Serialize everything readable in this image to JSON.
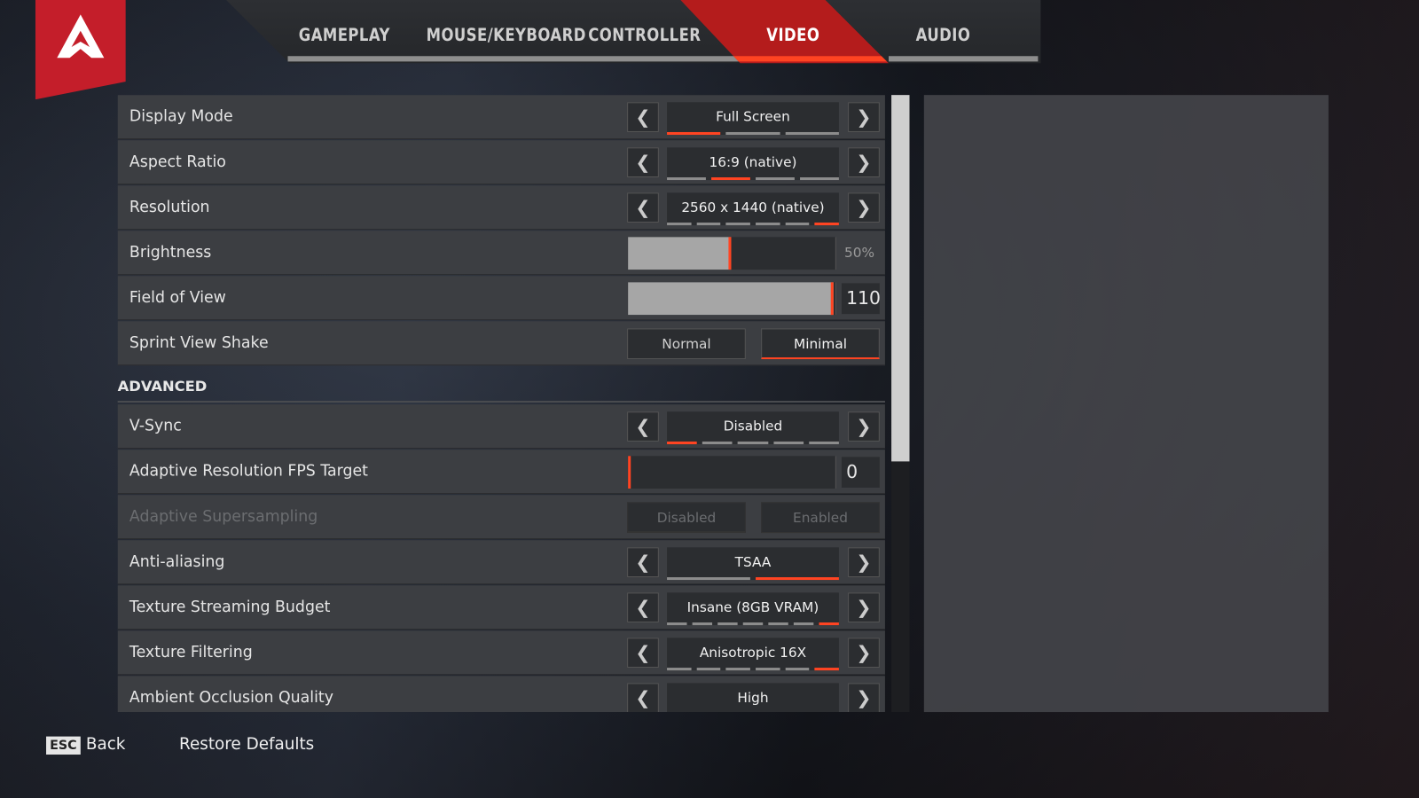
{
  "tabs": [
    {
      "label": "GAMEPLAY"
    },
    {
      "label": "MOUSE/KEYBOARD"
    },
    {
      "label": "CONTROLLER"
    },
    {
      "label": "VIDEO",
      "active": true
    },
    {
      "label": "AUDIO"
    }
  ],
  "accent": "#ff4422",
  "advanced_header": "ADVANCED",
  "rows": [
    {
      "label": "Display Mode",
      "type": "select",
      "value": "Full Screen",
      "options_count": 3,
      "selected_index": 0
    },
    {
      "label": "Aspect Ratio",
      "type": "select",
      "value": "16:9 (native)",
      "options_count": 4,
      "selected_index": 1
    },
    {
      "label": "Resolution",
      "type": "select",
      "value": "2560 x 1440 (native)",
      "options_count": 6,
      "selected_index": 5
    },
    {
      "label": "Brightness",
      "type": "slider",
      "value": "50%",
      "fraction": 0.5
    },
    {
      "label": "Field of View",
      "type": "slider_box",
      "value": "110",
      "fraction": 1.0
    },
    {
      "label": "Sprint View Shake",
      "type": "toggle",
      "options": [
        "Normal",
        "Minimal"
      ],
      "selected_index": 1
    }
  ],
  "advanced_rows": [
    {
      "label": "V-Sync",
      "type": "select",
      "value": "Disabled",
      "options_count": 5,
      "selected_index": 0
    },
    {
      "label": "Adaptive Resolution FPS Target",
      "type": "slider_box",
      "value": "0",
      "fraction": 0
    },
    {
      "label": "Adaptive Supersampling",
      "type": "toggle",
      "options": [
        "Disabled",
        "Enabled"
      ],
      "selected_index": 0,
      "disabled": true
    },
    {
      "label": "Anti-aliasing",
      "type": "select",
      "value": "TSAA",
      "options_count": 2,
      "selected_index": 1
    },
    {
      "label": "Texture Streaming Budget",
      "type": "select",
      "value": "Insane (8GB VRAM)",
      "options_count": 7,
      "selected_index": 6
    },
    {
      "label": "Texture Filtering",
      "type": "select",
      "value": "Anisotropic 16X",
      "options_count": 6,
      "selected_index": 5
    },
    {
      "label": "Ambient Occlusion Quality",
      "type": "select",
      "value": "High",
      "options_count": 0,
      "selected_index": -1
    }
  ],
  "footer": {
    "esc_key": "ESC",
    "back": "Back",
    "restore": "Restore Defaults"
  }
}
